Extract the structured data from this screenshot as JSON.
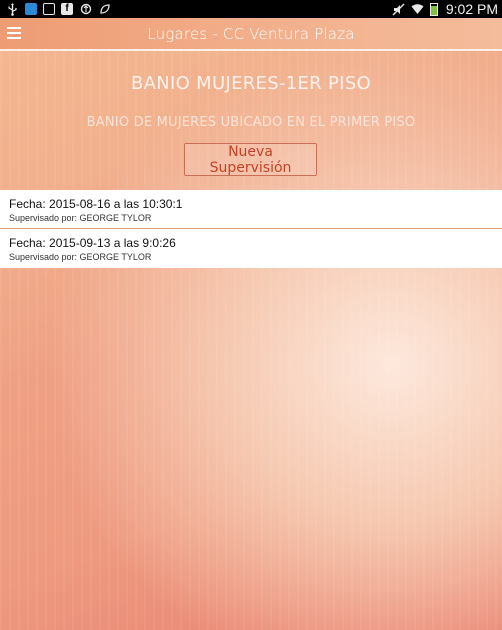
{
  "status_bar": {
    "icons": [
      "usb-icon",
      "skype-icon",
      "gallery-icon",
      "facebook-icon",
      "sync-icon",
      "data-saver-icon",
      "mute-icon",
      "wifi-icon",
      "battery-icon"
    ],
    "time": "9:02 PM",
    "battery_level": 0.8
  },
  "action_bar": {
    "title": "Lugares - CC Ventura Plaza",
    "menu_icon": "hamburger-menu-icon"
  },
  "place": {
    "name": "BANIO MUJERES-1ER PISO",
    "description": "BANIO DE MUJERES UBICADO EN EL PRIMER PISO",
    "new_supervision_label": "Nueva Supervisión"
  },
  "supervisions": [
    {
      "date_label": "Fecha: 2015-08-16 a las 10:30:1",
      "supervisor_label": "Supervisado por: GEORGE TYLOR"
    },
    {
      "date_label": "Fecha: 2015-09-13 a las 9:0:26",
      "supervisor_label": "Supervisado por: GEORGE TYLOR"
    }
  ],
  "colors": {
    "accent_button_text": "#c3432a",
    "background_top": "#f4b890",
    "background_bottom": "#e98070",
    "list_divider": "#d9a07a",
    "battery_fill": "#7ec241"
  }
}
